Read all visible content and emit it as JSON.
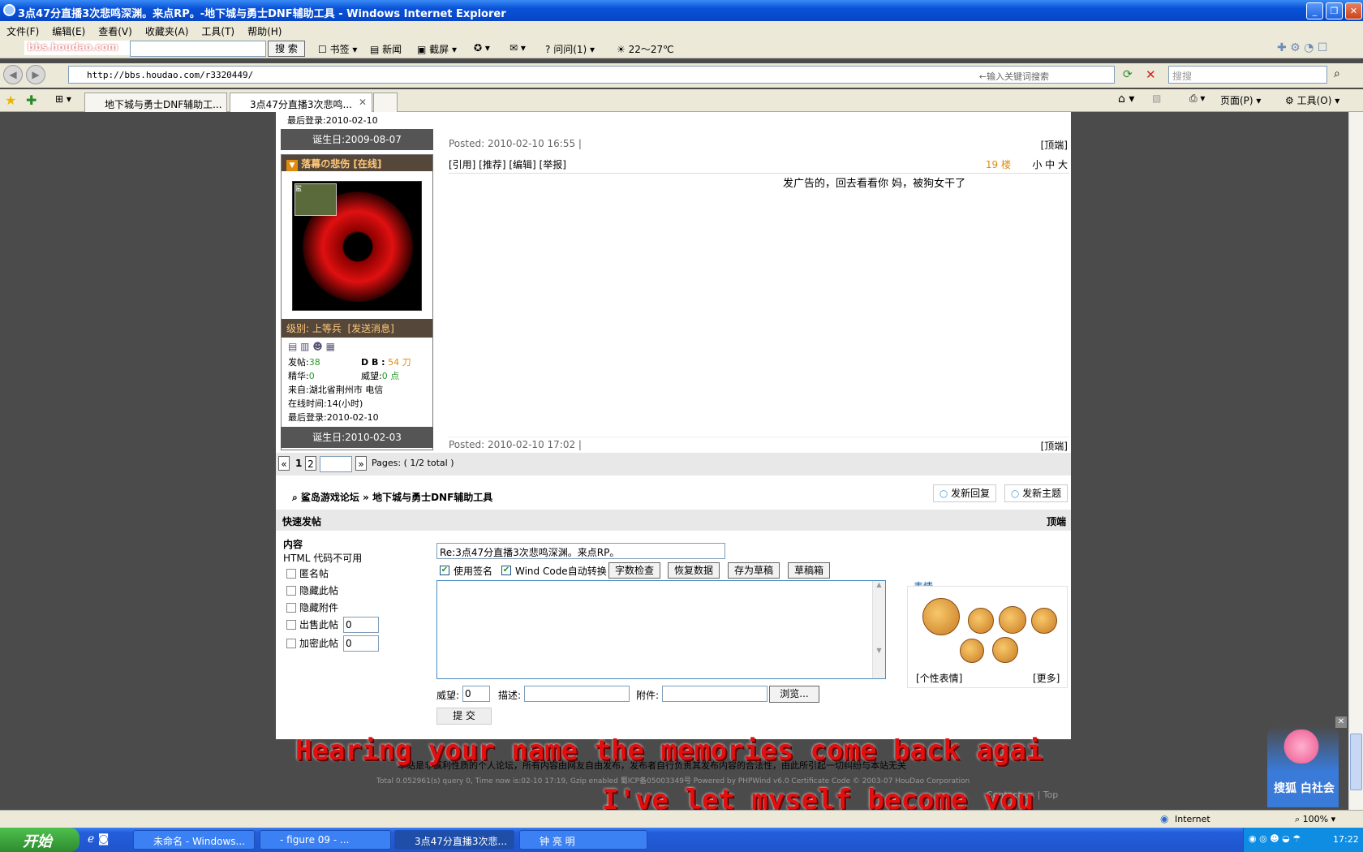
{
  "window": {
    "title": "3点47分直播3次悲鸣深渊。来点RP。-地下城与勇士DNF辅助工具 - Windows Internet Explorer"
  },
  "menu": {
    "items": [
      "文件(F)",
      "编辑(E)",
      "查看(V)",
      "收藏夹(A)",
      "工具(T)",
      "帮助(H)"
    ]
  },
  "toolbar": {
    "logo": "bbs.houdao.com",
    "search_btn": "搜 索",
    "bookmarks": "书签",
    "news": "新闻",
    "screenshot": "截屏",
    "ask": "问问(1)",
    "weather": "22～27℃"
  },
  "address": {
    "url": "http://bbs.houdao.com/r3320449/",
    "hint": "←输入关键词搜索",
    "search_placeholder": "搜搜"
  },
  "tabs": [
    {
      "label": "地下城与勇士DNF辅助工..."
    },
    {
      "label": "3点47分直播3次悲鸣..."
    }
  ],
  "cmdbar": {
    "page": "页面(P)",
    "tools": "工具(O)"
  },
  "prev_user": {
    "last_login": "最后登录:2010-02-10",
    "birthday": "诞生日:2009-08-07"
  },
  "user": {
    "name": "落幕の悲伤",
    "status": "[在线]",
    "level": "级别: 上等兵",
    "message": "[发送消息]",
    "posts_label": "发帖:",
    "posts": "38",
    "db_label": "D B :",
    "db": "54 刀",
    "essence_label": "精华:",
    "essence": "0",
    "prestige_label": "威望:",
    "prestige": "0 点",
    "from": "来自:湖北省荆州市 电信",
    "online": "在线时间:14(小时)",
    "last_login": "最后登录:2010-02-10",
    "birthday": "诞生日:2010-02-03"
  },
  "post": {
    "prev_posted": "Posted: 2010-02-10 16:55 |",
    "top": "[顶端]",
    "actions": "[引用] [推荐] [编辑] [举报]",
    "floor": "19 楼",
    "sizes": "小 中 大",
    "content": "发广告的，回去看看你 妈，被狗女干了",
    "posted": "Posted: 2010-02-10 17:02 |"
  },
  "pager": {
    "first": "«",
    "p1": "1",
    "p2": "2",
    "last": "»",
    "info": "Pages: ( 1/2 total )"
  },
  "breadcrumb": {
    "home": "鲨岛游戏论坛",
    "sep": "»",
    "forum": "地下城与勇士DNF辅助工具"
  },
  "buttons": {
    "reply": "发新回复",
    "new_topic": "发新主题"
  },
  "quick": {
    "title": "快速发帖",
    "top": "顶端",
    "content_label": "内容",
    "html_note": "HTML 代码不可用",
    "anon": "匿名帖",
    "hide_post": "隐藏此帖",
    "hide_attach": "隐藏附件",
    "sell": "出售此帖",
    "sell_val": "0",
    "encrypt": "加密此帖",
    "encrypt_val": "0",
    "subject": "Re:3点47分直播3次悲鸣深渊。来点RP。",
    "use_sig": "使用签名",
    "windcode": "Wind Code自动转换",
    "btn_count": "字数检查",
    "btn_restore": "恢复数据",
    "btn_draft": "存为草稿",
    "btn_drafts": "草稿箱",
    "prestige": "威望:",
    "prestige_val": "0",
    "desc": "描述:",
    "attach": "附件:",
    "browse": "浏览...",
    "submit": "提 交",
    "emoticons": "表情",
    "personal_emo": "[个性表情]",
    "more": "[更多]"
  },
  "footer": {
    "line1": "本站是非赢利性质的个人论坛，所有内容由网友自由发布，发布者自行负责其发布内容的合法性，由此所引起一切纠纷与本站无关",
    "line2": "Total 0.052961(s) query 0, Time now is:02-10 17:19, Gzip enabled 蜀ICP备05003349号 Powered by PHPWind v6.0 Certificate Code © 2003-07 HouDao Corporation",
    "contact": "Contact us | Top"
  },
  "lyrics": {
    "line1": "Hearing your name the memories come back agai",
    "line2": "I've let myself become you"
  },
  "widget": {
    "label": "搜狐 白社会"
  },
  "statusbar": {
    "zone": "Internet",
    "zoom": "100%"
  },
  "taskbar": {
    "start": "开始",
    "items": [
      "未命名 - Windows...",
      "- figure 09 - ...",
      "3点47分直播3次悲...",
      "钟 亮 明"
    ],
    "clock": "17:22"
  },
  "colors": {
    "titlebar": "#0a52d8",
    "taskbar": "#245edb",
    "lyric": "#e01010",
    "sidebar_dark": "#555555"
  }
}
